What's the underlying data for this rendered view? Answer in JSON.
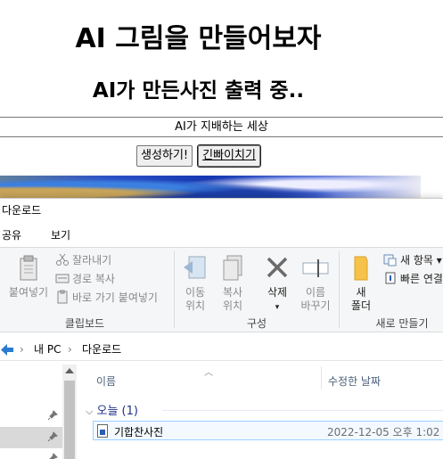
{
  "web": {
    "heading": "AI 그림을 만들어보자",
    "subheading": "AI가 만든사진 출력 중..",
    "banner": "AI가 지배하는 세상",
    "generate_button": "생성하기!",
    "pre_button": "긴빠이치기"
  },
  "explorer": {
    "title": "다운로드",
    "tabs": [
      "공유",
      "보기"
    ],
    "ribbon": {
      "paste": "붙여넣기",
      "cut": "잘라내기",
      "copy_path": "경로 복사",
      "paste_shortcut": "바로 가기 붙여넣기",
      "clipboard_group": "클립보드",
      "move_to_1": "이동",
      "move_to_2": "위치",
      "copy_to_1": "복사",
      "copy_to_2": "위치",
      "delete": "삭제",
      "rename_1": "이름",
      "rename_2": "바꾸기",
      "organize_group": "구성",
      "new_folder_1": "새",
      "new_folder_2": "폴더",
      "new_item": "새 항목",
      "easy_access": "빠른 연결",
      "new_group": "새로 만들기"
    },
    "address": {
      "pc": "내 PC",
      "folder": "다운로드"
    },
    "columns": {
      "name": "이름",
      "date_modified": "수정한 날짜"
    },
    "group": {
      "label": "오늘 (1)"
    },
    "files": [
      {
        "name": "기합찬사진",
        "modified": "2022-12-05 오후 1:02"
      }
    ]
  },
  "colors": {
    "accent_blue": "#1e3287",
    "selection_border": "#99d1ff",
    "folder_yellow": "#f6c34a"
  }
}
